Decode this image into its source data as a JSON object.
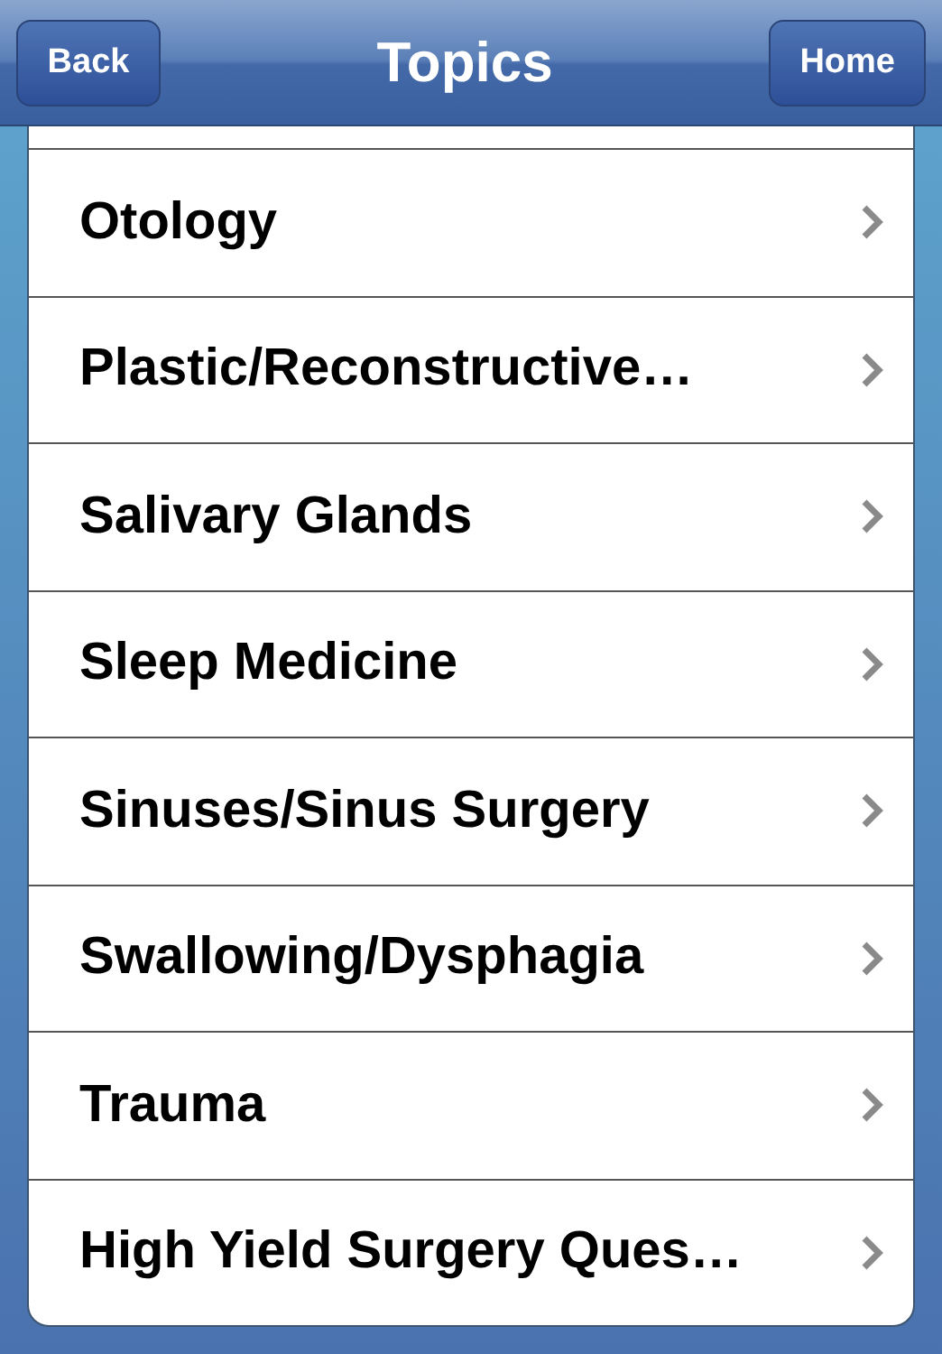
{
  "nav_bar": {
    "title": "Topics",
    "back_button": "Back",
    "home_button": "Home"
  },
  "topics": [
    {
      "label": "Otology"
    },
    {
      "label": "Plastic/Reconstructive…"
    },
    {
      "label": "Salivary Glands"
    },
    {
      "label": "Sleep Medicine"
    },
    {
      "label": "Sinuses/Sinus Surgery"
    },
    {
      "label": "Swallowing/Dysphagia"
    },
    {
      "label": "Trauma"
    },
    {
      "label": "High Yield Surgery Ques…"
    }
  ]
}
